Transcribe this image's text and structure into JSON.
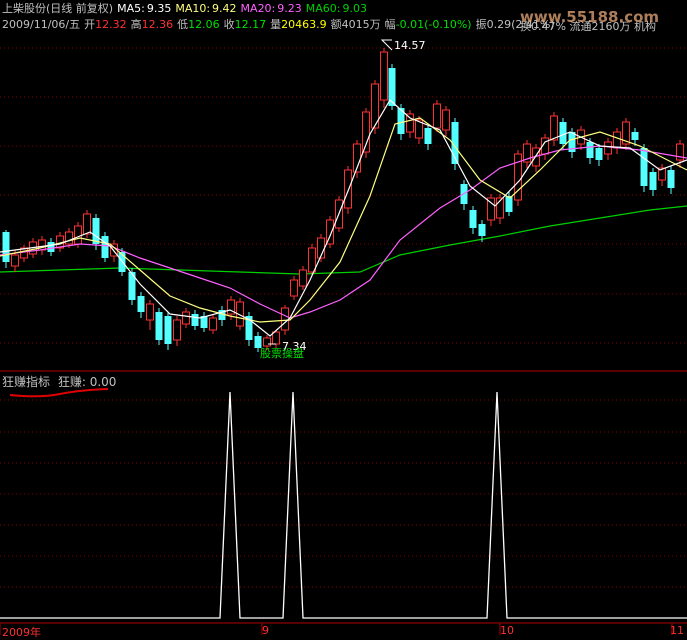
{
  "header": {
    "title": "上柴股份(日线 前复权)",
    "ma5_label": "MA5:",
    "ma5_value": "9.35",
    "ma10_label": "MA10:",
    "ma10_value": "9.42",
    "ma20_label": "MA20:",
    "ma20_value": "9.23",
    "ma60_label": "MA60:",
    "ma60_value": "9.03",
    "date": "2009/11/06/五",
    "open_label": "开",
    "open_value": "12.32",
    "high_label": "高",
    "high_value": "12.36",
    "low_label": "低",
    "low_value": "12.06",
    "close_label": "收",
    "close_value": "12.17",
    "volume_label": "量",
    "volume_value": "20463.9",
    "amount_label": "额",
    "amount_value": "4015万",
    "change_label": "幅",
    "change_value": "-0.01(-0.10%)",
    "amplitude_label": "振",
    "amplitude_value": "0.29(2.41%)",
    "turnover_label": "换",
    "turnover_value": "0.47%",
    "float_label": "流通",
    "float_value": "2160万",
    "inst_label": "机构",
    "watermark": "www.55188.com"
  },
  "price_panel": {
    "high_marker": "14.57",
    "low_marker": "7.34",
    "signal_text": "股票操盘"
  },
  "indicator": {
    "name": "狂赚指标",
    "label": "狂赚:",
    "value": "0.00"
  },
  "axis": {
    "labels": [
      "2009年",
      "9",
      "10",
      "11"
    ]
  },
  "colors": {
    "up": "#ff3232",
    "down": "#54ffff",
    "ma5": "#ffffff",
    "ma10": "#ffff80",
    "ma20": "#ff60ff",
    "ma60": "#00d000",
    "grid": "#800000",
    "signal": "#00e000"
  }
}
